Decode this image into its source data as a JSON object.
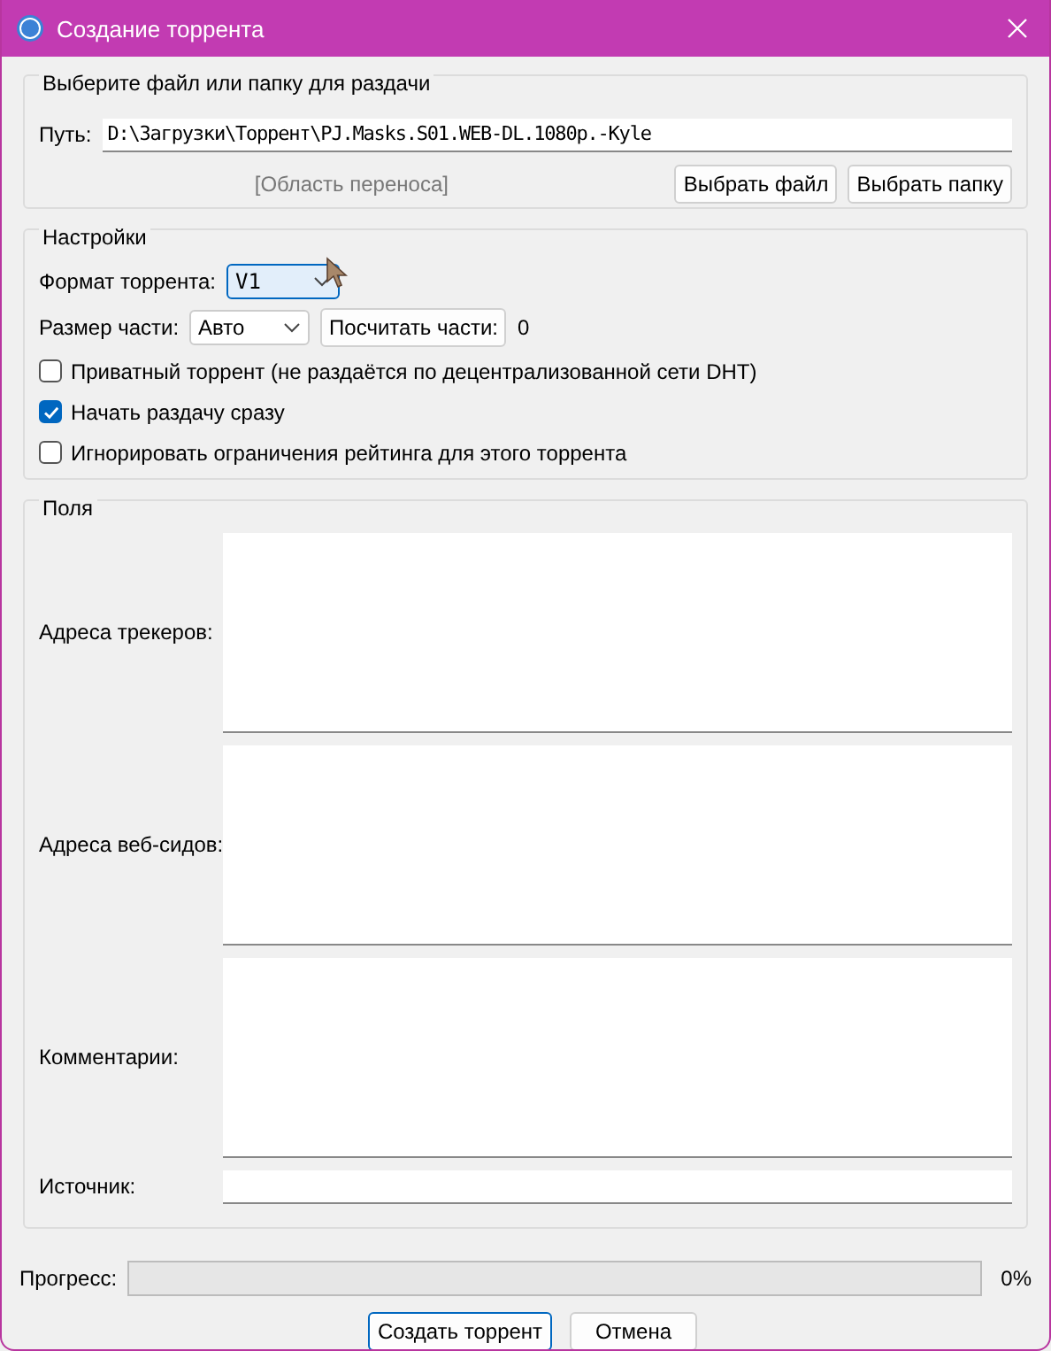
{
  "window": {
    "title": "Создание торрента"
  },
  "source_group": {
    "title": "Выберите файл или папку для раздачи",
    "path_label": "Путь:",
    "path_value": "D:\\Загрузки\\Торрент\\PJ.Masks.S01.WEB-DL.1080p.-Kyle",
    "drop_area": "[Область переноса]",
    "buttons": [
      "Выбрать файл",
      "Выбрать папку"
    ]
  },
  "settings": {
    "title": "Настройки",
    "format_label": "Формат торрента:",
    "format_value": "V1",
    "piece_size_label": "Размер части:",
    "piece_size_value": "Авто",
    "calc_button": "Посчитать части:",
    "piece_count": "0",
    "options": [
      {
        "label": "Приватный торрент (не раздаётся по децентрализованной сети DHT)",
        "checked": false
      },
      {
        "label": "Начать раздачу сразу",
        "checked": true
      },
      {
        "label": "Игнорировать ограничения рейтинга для этого торрента",
        "checked": false
      }
    ]
  },
  "fields": {
    "title": "Поля",
    "items": [
      {
        "label": "Адреса трекеров:",
        "kind": "multiline"
      },
      {
        "label": "Адреса веб-сидов:",
        "kind": "multiline"
      },
      {
        "label": "Комментарии:",
        "kind": "multiline"
      },
      {
        "label": "Источник:",
        "kind": "line"
      }
    ]
  },
  "progress": {
    "label": "Прогресс:",
    "level": 0,
    "reading": "0%"
  },
  "buttons": [
    {
      "label": "Создать торрент",
      "default": true
    },
    {
      "label": "Отмена",
      "default": false
    }
  ]
}
